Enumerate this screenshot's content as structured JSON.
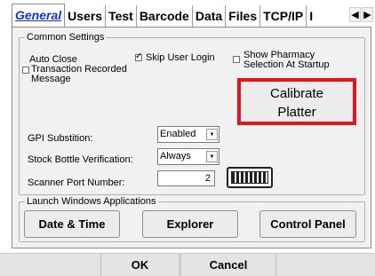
{
  "tabs": [
    {
      "label": "General",
      "active": true
    },
    {
      "label": "Users"
    },
    {
      "label": "Test"
    },
    {
      "label": "Barcode"
    },
    {
      "label": "Data"
    },
    {
      "label": "Files"
    },
    {
      "label": "TCP/IP"
    },
    {
      "label": "I"
    }
  ],
  "tab_scroll": {
    "prev": "◀",
    "next": "▶"
  },
  "common_settings": {
    "legend": "Common Settings",
    "auto_close": {
      "label_line1": "Auto Close",
      "label_line2": "Transaction Recorded",
      "label_line3": "Message",
      "checked": false
    },
    "skip_user_login": {
      "label": "Skip User Login",
      "checked": true
    },
    "show_pharmacy": {
      "label_line1": "Show Pharmacy",
      "label_line2": "Selection At Startup",
      "checked": false
    },
    "calibrate": {
      "line1": "Calibrate",
      "line2": "Platter"
    },
    "gpi_substitution": {
      "label": "GPI Substition:",
      "value": "Enabled"
    },
    "stock_bottle": {
      "label": "Stock Bottle Verification:",
      "value": "Always"
    },
    "scanner_port": {
      "label": "Scanner Port Number:",
      "value": "2"
    }
  },
  "launch_apps": {
    "legend": "Launch Windows Applications",
    "date_time": "Date & Time",
    "explorer": "Explorer",
    "control_panel": "Control Panel"
  },
  "footer": {
    "ok": "OK",
    "cancel": "Cancel"
  },
  "colors": {
    "active_tab": "#1534c8",
    "highlight_border": "#e3141a"
  }
}
